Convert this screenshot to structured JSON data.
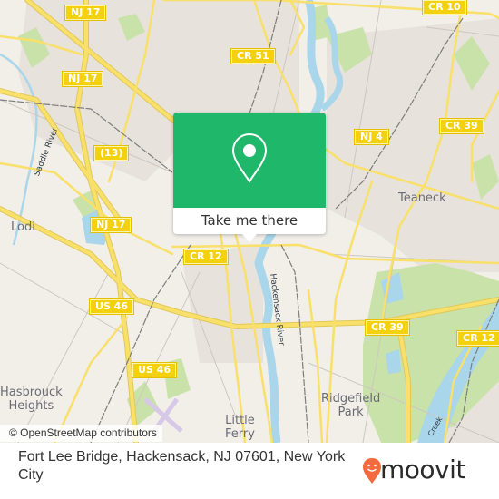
{
  "map": {
    "colors": {
      "land": "#f2efe9",
      "urban": "#e7e1db",
      "park": "#c8e3a8",
      "water": "#a9d6ea",
      "road_major": "#f8e06a",
      "road_casing": "#e0c85a",
      "road_minor": "#c8c2bb",
      "rail": "#777777"
    },
    "road_shields": [
      {
        "label": "NJ 17",
        "id": "nj17-north"
      },
      {
        "label": "NJ 17",
        "id": "nj17-mid"
      },
      {
        "label": "(13)",
        "id": "route-13"
      },
      {
        "label": "NJ 17",
        "id": "nj17-south"
      },
      {
        "label": "CR 10",
        "id": "cr10"
      },
      {
        "label": "CR 51",
        "id": "cr51"
      },
      {
        "label": "NJ 4",
        "id": "nj4"
      },
      {
        "label": "CR 39",
        "id": "cr39-north"
      },
      {
        "label": "CR 12",
        "id": "cr12-west"
      },
      {
        "label": "US 46",
        "id": "us46-north"
      },
      {
        "label": "CR 39",
        "id": "cr39-south"
      },
      {
        "label": "CR 12",
        "id": "cr12-east"
      },
      {
        "label": "US 46",
        "id": "us46-south"
      }
    ],
    "places": [
      {
        "label": "Teaneck"
      },
      {
        "label": "Lodi"
      },
      {
        "label": "Hasbrouck\nHeights"
      },
      {
        "label": "Ridgefield\nPark"
      },
      {
        "label": "Little\nFerry"
      }
    ],
    "water_labels": [
      {
        "label": "Saddle River"
      },
      {
        "label": "Hackensack River"
      },
      {
        "label": "Creek"
      }
    ],
    "attribution": "© OpenStreetMap contributors"
  },
  "popup": {
    "icon": "map-pin-icon",
    "action_label": "Take me there",
    "accent_color": "#1fb86a"
  },
  "footer": {
    "address": "Fort Lee Bridge, Hackensack, NJ 07601, New York City",
    "brand": "moovit",
    "brand_icon": "moovit-smiley-pin-icon",
    "brand_color": "#f26a3d"
  }
}
